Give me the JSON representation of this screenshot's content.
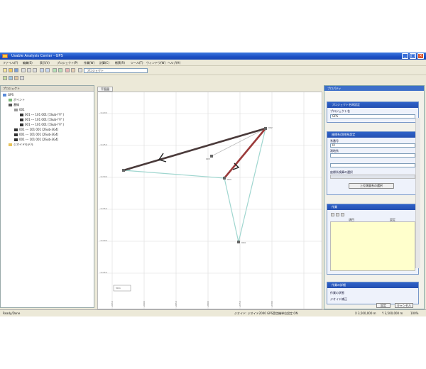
{
  "window": {
    "title": "Usable Analysis Center - GPS",
    "controls": {
      "minimize": "_",
      "maximize": "□",
      "close": "×"
    }
  },
  "menu": [
    "ファイル(F)",
    "編集(E)",
    "表示(V)",
    "プロジェクト(P)",
    "作業(W)",
    "計算(C)",
    "帳票(R)",
    "ツール(T)",
    "ウィンドウ(W)",
    "ヘルプ(H)"
  ],
  "toolbar": {
    "select_value": "プロジェクト"
  },
  "tree": {
    "header": "プロジェクト",
    "nodes": [
      {
        "label": "GPS",
        "indent": 0
      },
      {
        "label": "ポイント",
        "indent": 1
      },
      {
        "label": "基線",
        "indent": 1
      },
      {
        "label": "001",
        "indent": 2
      },
      {
        "label": "001 --- 101 001 [1Sub-??? ]",
        "indent": 3
      },
      {
        "label": "001 --- 101 001 [1Sub-??? ]",
        "indent": 3
      },
      {
        "label": "001 --- 101 001 [1Sub-??? ]",
        "indent": 3
      },
      {
        "label": "001 --- 101 001 [2Sub-3G4]",
        "indent": 3
      },
      {
        "label": "001 --- 101 001 [2Sub-3G4]",
        "indent": 3
      },
      {
        "label": "001 --- 101 001 [2Sub-3G4]",
        "indent": 3
      },
      {
        "label": "ジオイドモデル",
        "indent": 1
      }
    ]
  },
  "map": {
    "tab_label": "平面図",
    "y_ticks": [
      "-11200",
      "-11250",
      "-11300",
      "-11350",
      "-11400",
      "-11450"
    ],
    "x_ticks": [
      "-2950",
      "-2900",
      "-2850",
      "-2800",
      "-2750",
      "-2700"
    ],
    "points": [
      {
        "name": "001"
      },
      {
        "name": "002"
      },
      {
        "name": "003"
      },
      {
        "name": "004"
      },
      {
        "name": "005"
      }
    ],
    "scale_label": "50m"
  },
  "properties": {
    "title": "プロパティ",
    "section1": {
      "head": "プロジェクト名称設定",
      "label1": "プロジェクト名",
      "value1": "GPS"
    },
    "section2": {
      "head": "座標系/測地系設定",
      "label1": "系番号",
      "value1": "IX",
      "label2": "測地系",
      "value2": "",
      "label3": "",
      "value3": "",
      "label4": "座標系換算の選択",
      "button": "上位測量系の選択"
    },
    "section3": {
      "head": "作業",
      "col1": "項目",
      "col2": "設定"
    },
    "section4": {
      "head": "作業の詳細",
      "row1": "作業の状態",
      "row2": "ジオイド補正"
    },
    "ok": "設定",
    "cancel": "キャンセル"
  },
  "status": {
    "left": "Ready/Done",
    "center": "ジオイド: ジオイド2000   GPS受信機単位設定 ON",
    "right1": "X 3,500,000 m",
    "right2": "Y 3,500,000 m",
    "right3": "100%"
  },
  "colors": {
    "titlebar": "#1c4fc4",
    "dark_line": "#4a3a3a",
    "red_line": "#9b3a3a",
    "teal_line": "#9fd6cf"
  }
}
